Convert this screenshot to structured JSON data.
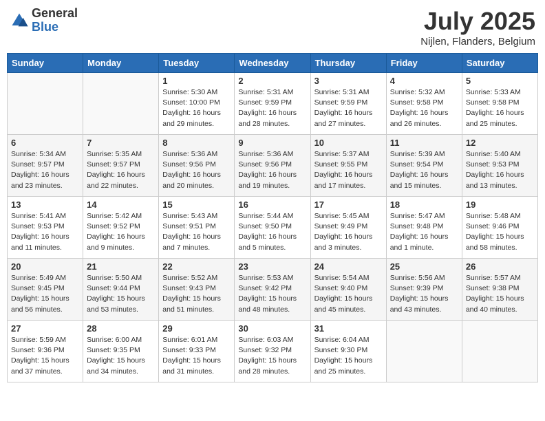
{
  "logo": {
    "general": "General",
    "blue": "Blue"
  },
  "title": {
    "month_year": "July 2025",
    "location": "Nijlen, Flanders, Belgium"
  },
  "headers": [
    "Sunday",
    "Monday",
    "Tuesday",
    "Wednesday",
    "Thursday",
    "Friday",
    "Saturday"
  ],
  "weeks": [
    [
      {
        "day": "",
        "detail": ""
      },
      {
        "day": "",
        "detail": ""
      },
      {
        "day": "1",
        "detail": "Sunrise: 5:30 AM\nSunset: 10:00 PM\nDaylight: 16 hours\nand 29 minutes."
      },
      {
        "day": "2",
        "detail": "Sunrise: 5:31 AM\nSunset: 9:59 PM\nDaylight: 16 hours\nand 28 minutes."
      },
      {
        "day": "3",
        "detail": "Sunrise: 5:31 AM\nSunset: 9:59 PM\nDaylight: 16 hours\nand 27 minutes."
      },
      {
        "day": "4",
        "detail": "Sunrise: 5:32 AM\nSunset: 9:58 PM\nDaylight: 16 hours\nand 26 minutes."
      },
      {
        "day": "5",
        "detail": "Sunrise: 5:33 AM\nSunset: 9:58 PM\nDaylight: 16 hours\nand 25 minutes."
      }
    ],
    [
      {
        "day": "6",
        "detail": "Sunrise: 5:34 AM\nSunset: 9:57 PM\nDaylight: 16 hours\nand 23 minutes."
      },
      {
        "day": "7",
        "detail": "Sunrise: 5:35 AM\nSunset: 9:57 PM\nDaylight: 16 hours\nand 22 minutes."
      },
      {
        "day": "8",
        "detail": "Sunrise: 5:36 AM\nSunset: 9:56 PM\nDaylight: 16 hours\nand 20 minutes."
      },
      {
        "day": "9",
        "detail": "Sunrise: 5:36 AM\nSunset: 9:56 PM\nDaylight: 16 hours\nand 19 minutes."
      },
      {
        "day": "10",
        "detail": "Sunrise: 5:37 AM\nSunset: 9:55 PM\nDaylight: 16 hours\nand 17 minutes."
      },
      {
        "day": "11",
        "detail": "Sunrise: 5:39 AM\nSunset: 9:54 PM\nDaylight: 16 hours\nand 15 minutes."
      },
      {
        "day": "12",
        "detail": "Sunrise: 5:40 AM\nSunset: 9:53 PM\nDaylight: 16 hours\nand 13 minutes."
      }
    ],
    [
      {
        "day": "13",
        "detail": "Sunrise: 5:41 AM\nSunset: 9:53 PM\nDaylight: 16 hours\nand 11 minutes."
      },
      {
        "day": "14",
        "detail": "Sunrise: 5:42 AM\nSunset: 9:52 PM\nDaylight: 16 hours\nand 9 minutes."
      },
      {
        "day": "15",
        "detail": "Sunrise: 5:43 AM\nSunset: 9:51 PM\nDaylight: 16 hours\nand 7 minutes."
      },
      {
        "day": "16",
        "detail": "Sunrise: 5:44 AM\nSunset: 9:50 PM\nDaylight: 16 hours\nand 5 minutes."
      },
      {
        "day": "17",
        "detail": "Sunrise: 5:45 AM\nSunset: 9:49 PM\nDaylight: 16 hours\nand 3 minutes."
      },
      {
        "day": "18",
        "detail": "Sunrise: 5:47 AM\nSunset: 9:48 PM\nDaylight: 16 hours\nand 1 minute."
      },
      {
        "day": "19",
        "detail": "Sunrise: 5:48 AM\nSunset: 9:46 PM\nDaylight: 15 hours\nand 58 minutes."
      }
    ],
    [
      {
        "day": "20",
        "detail": "Sunrise: 5:49 AM\nSunset: 9:45 PM\nDaylight: 15 hours\nand 56 minutes."
      },
      {
        "day": "21",
        "detail": "Sunrise: 5:50 AM\nSunset: 9:44 PM\nDaylight: 15 hours\nand 53 minutes."
      },
      {
        "day": "22",
        "detail": "Sunrise: 5:52 AM\nSunset: 9:43 PM\nDaylight: 15 hours\nand 51 minutes."
      },
      {
        "day": "23",
        "detail": "Sunrise: 5:53 AM\nSunset: 9:42 PM\nDaylight: 15 hours\nand 48 minutes."
      },
      {
        "day": "24",
        "detail": "Sunrise: 5:54 AM\nSunset: 9:40 PM\nDaylight: 15 hours\nand 45 minutes."
      },
      {
        "day": "25",
        "detail": "Sunrise: 5:56 AM\nSunset: 9:39 PM\nDaylight: 15 hours\nand 43 minutes."
      },
      {
        "day": "26",
        "detail": "Sunrise: 5:57 AM\nSunset: 9:38 PM\nDaylight: 15 hours\nand 40 minutes."
      }
    ],
    [
      {
        "day": "27",
        "detail": "Sunrise: 5:59 AM\nSunset: 9:36 PM\nDaylight: 15 hours\nand 37 minutes."
      },
      {
        "day": "28",
        "detail": "Sunrise: 6:00 AM\nSunset: 9:35 PM\nDaylight: 15 hours\nand 34 minutes."
      },
      {
        "day": "29",
        "detail": "Sunrise: 6:01 AM\nSunset: 9:33 PM\nDaylight: 15 hours\nand 31 minutes."
      },
      {
        "day": "30",
        "detail": "Sunrise: 6:03 AM\nSunset: 9:32 PM\nDaylight: 15 hours\nand 28 minutes."
      },
      {
        "day": "31",
        "detail": "Sunrise: 6:04 AM\nSunset: 9:30 PM\nDaylight: 15 hours\nand 25 minutes."
      },
      {
        "day": "",
        "detail": ""
      },
      {
        "day": "",
        "detail": ""
      }
    ]
  ]
}
